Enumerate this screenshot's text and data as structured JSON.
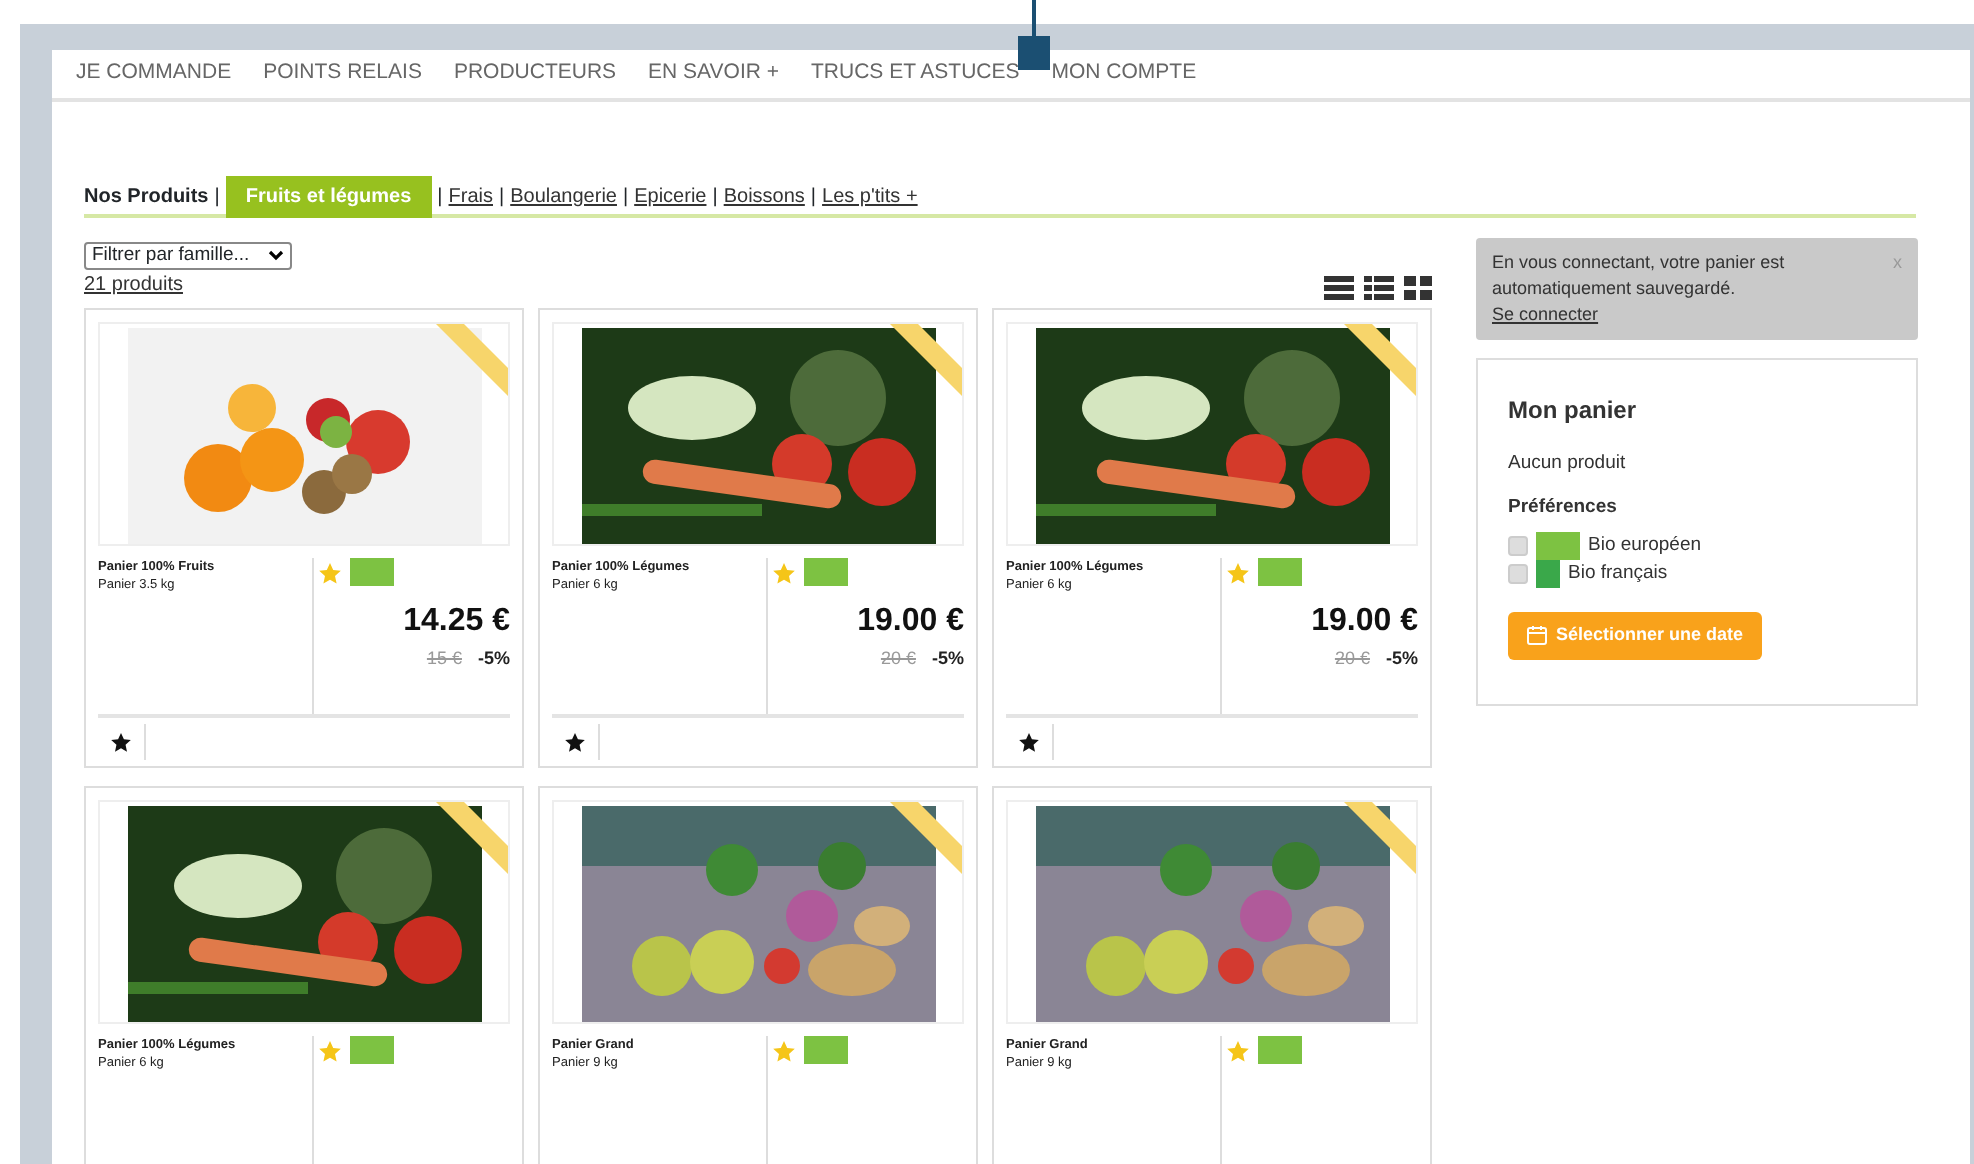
{
  "nav": {
    "items": [
      "JE COMMANDE",
      "POINTS RELAIS",
      "PRODUCTEURS",
      "EN SAVOIR +",
      "TRUCS ET ASTUCES",
      "MON COMPTE"
    ]
  },
  "categories": {
    "title": "Nos Produits",
    "separator": "|",
    "items": [
      {
        "label": "Fruits et légumes",
        "selected": true
      },
      {
        "label": "Frais",
        "selected": false
      },
      {
        "label": "Boulangerie",
        "selected": false
      },
      {
        "label": "Epicerie",
        "selected": false
      },
      {
        "label": "Boissons",
        "selected": false
      },
      {
        "label": "Les p'tits +",
        "selected": false
      }
    ]
  },
  "filter": {
    "value": "Filtrer par famille..."
  },
  "count": "21 produits",
  "products": [
    {
      "kind": "fruits",
      "name": "Panier 100% Fruits",
      "weight": "Panier 3.5 kg",
      "price": "14.25 €",
      "old_price": "15 €",
      "discount": "-5%"
    },
    {
      "kind": "vegetables",
      "name": "Panier 100% Légumes",
      "weight": "Panier 6 kg",
      "price": "19.00 €",
      "old_price": "20 €",
      "discount": "-5%"
    },
    {
      "kind": "vegetables",
      "name": "Panier 100% Légumes",
      "weight": "Panier 6 kg",
      "price": "19.00 €",
      "old_price": "20 €",
      "discount": "-5%"
    },
    {
      "kind": "vegetables",
      "name": "Panier 100% Légumes",
      "weight": "Panier 6 kg"
    },
    {
      "kind": "crate",
      "name": "Panier Grand",
      "weight": "Panier 9 kg"
    },
    {
      "kind": "crate",
      "name": "Panier Grand",
      "weight": "Panier 9 kg"
    }
  ],
  "alert": {
    "text": "En vous connectant, votre panier est automatiquement sauvegardé.",
    "link": "Se connecter",
    "close": "x"
  },
  "cart": {
    "title": "Mon panier",
    "empty": "Aucun produit",
    "preferences_title": "Préférences",
    "preferences": [
      {
        "kind": "eu",
        "label": "Bio européen",
        "checked": false
      },
      {
        "kind": "fr",
        "label": "Bio français",
        "checked": false
      }
    ],
    "button": "Sélectionner une date"
  }
}
